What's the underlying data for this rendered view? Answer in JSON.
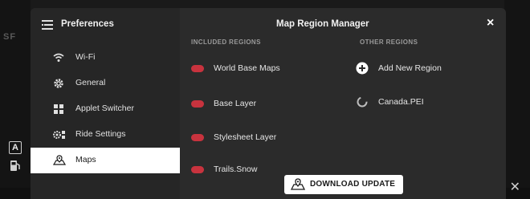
{
  "background": {
    "ghost_text": "SF"
  },
  "sidebar": {
    "title": "Preferences",
    "items": [
      {
        "label": "Wi-Fi",
        "icon": "wifi-icon"
      },
      {
        "label": "General",
        "icon": "gear-icon"
      },
      {
        "label": "Applet Switcher",
        "icon": "grid-icon"
      },
      {
        "label": "Ride Settings",
        "icon": "ride-settings-icon"
      },
      {
        "label": "Maps",
        "icon": "map-icon",
        "active": true
      }
    ]
  },
  "dialog": {
    "title": "Map Region Manager",
    "close_label": "×"
  },
  "included": {
    "header": "INCLUDED REGIONS",
    "items": [
      "World Base Maps",
      "Base Layer",
      "Stylesheet Layer",
      "Trails.Snow"
    ]
  },
  "other": {
    "header": "OTHER REGIONS",
    "items": [
      {
        "label": "Add New Region",
        "icon": "plus-icon"
      },
      {
        "label": "Canada.PEI",
        "icon": "loading-icon"
      }
    ]
  },
  "download": {
    "label": "DOWNLOAD UPDATE"
  },
  "colors": {
    "accent_red": "#c8333e",
    "panel": "#2b2b2b",
    "sidebar": "#262626"
  }
}
